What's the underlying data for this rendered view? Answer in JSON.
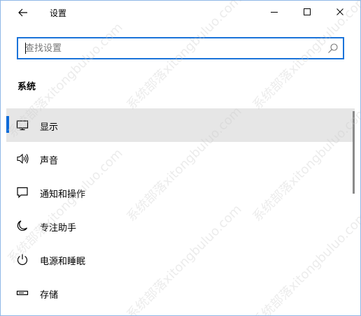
{
  "window": {
    "title": "设置",
    "icons": {
      "back": "back-arrow-icon",
      "minimize": "minimize-icon",
      "maximize": "maximize-icon",
      "close": "close-icon"
    }
  },
  "search": {
    "placeholder": "查找设置",
    "value": "",
    "icon": "search-icon"
  },
  "section": {
    "title": "系统"
  },
  "menu": {
    "items": [
      {
        "label": "显示",
        "icon": "monitor-icon",
        "selected": true
      },
      {
        "label": "声音",
        "icon": "speaker-icon",
        "selected": false
      },
      {
        "label": "通知和操作",
        "icon": "notification-icon",
        "selected": false
      },
      {
        "label": "专注助手",
        "icon": "moon-icon",
        "selected": false
      },
      {
        "label": "电源和睡眠",
        "icon": "power-icon",
        "selected": false
      },
      {
        "label": "存储",
        "icon": "storage-icon",
        "selected": false
      }
    ]
  },
  "watermark": {
    "text": "系统部落xitongbuluo.com"
  },
  "colors": {
    "accent": "#0a6ad8",
    "search_border": "#1a73d9",
    "selected_bg": "#e6e6e6"
  }
}
